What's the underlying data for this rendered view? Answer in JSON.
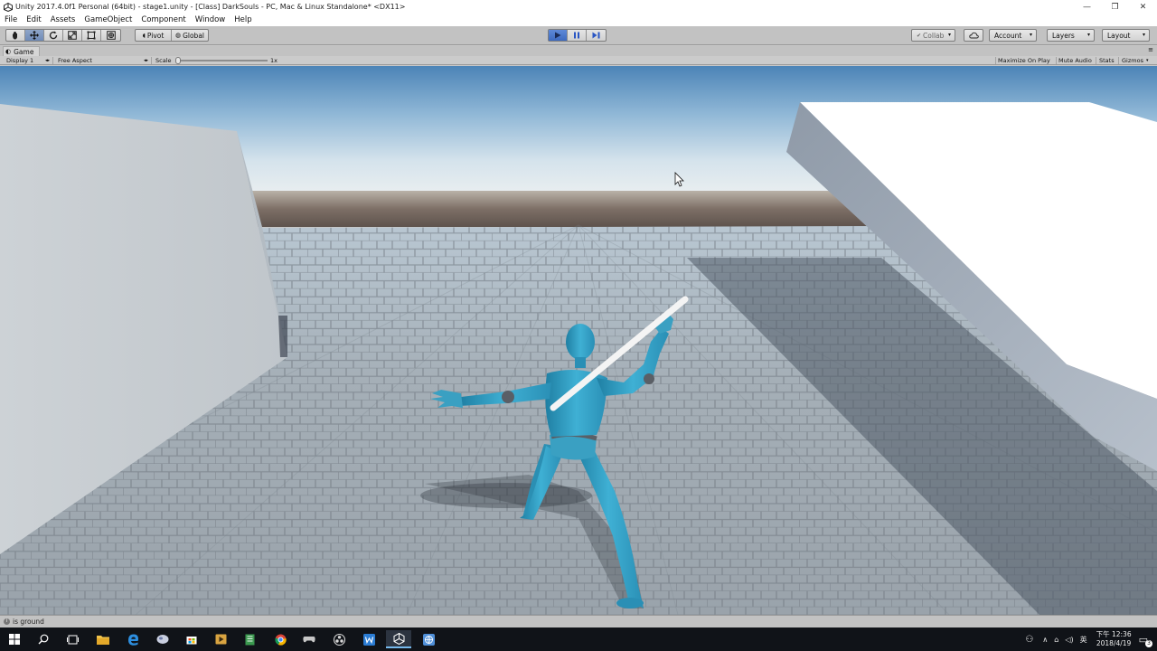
{
  "window": {
    "title": "Unity 2017.4.0f1 Personal (64bit) - stage1.unity - [Class] DarkSouls - PC, Mac & Linux Standalone* <DX11>",
    "minimize_label": "—",
    "restore_label": "❐",
    "close_label": "✕"
  },
  "menu": [
    "File",
    "Edit",
    "Assets",
    "GameObject",
    "Component",
    "Window",
    "Help"
  ],
  "toolbar": {
    "pivot_label": "Pivot",
    "global_label": "Global",
    "collab_label": "Collab",
    "account_label": "Account",
    "layers_label": "Layers",
    "layout_label": "Layout"
  },
  "game_view": {
    "tab_label": "Game",
    "display_label": "Display 1",
    "aspect_label": "Free Aspect",
    "scale_label": "Scale",
    "scale_value": "1x",
    "maximize_label": "Maximize On Play",
    "mute_label": "Mute Audio",
    "stats_label": "Stats",
    "gizmos_label": "Gizmos"
  },
  "status": {
    "message": "is ground"
  },
  "taskbar": {
    "time": "下午 12:36",
    "date": "2018/4/19",
    "ime_label": "英",
    "notification_count": "3"
  },
  "colors": {
    "sky_top": "#4f86b8",
    "sky_horizon": "#e6edf0",
    "character": "#3aa0c2",
    "play_active": "#3d6ac0"
  }
}
